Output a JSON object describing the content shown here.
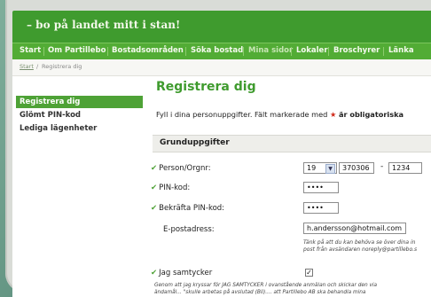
{
  "header": {
    "slogan": "– bo på landet mitt i stan!"
  },
  "nav": {
    "items": [
      {
        "label": "Start",
        "faded": false
      },
      {
        "label": "Om Partillebo",
        "faded": false
      },
      {
        "label": "Bostadsområden",
        "faded": false
      },
      {
        "label": "Söka bostad",
        "faded": false
      },
      {
        "label": "Mina sidor",
        "faded": true
      },
      {
        "label": "Lokaler",
        "faded": false
      },
      {
        "label": "Broschyrer",
        "faded": false
      },
      {
        "label": "Länka",
        "faded": false
      }
    ]
  },
  "breadcrumb": {
    "home": "Start",
    "separator": "/",
    "current": "Registrera dig"
  },
  "sidebar": {
    "items": [
      {
        "label": "Registrera dig",
        "active": true
      },
      {
        "label": "Glömt PIN-kod",
        "active": false
      },
      {
        "label": "Lediga lägenheter",
        "active": false
      }
    ]
  },
  "main": {
    "title": "Registrera dig",
    "intro_prefix": "Fyll i dina personuppgifter. Fält markerade med",
    "intro_star": "★",
    "intro_suffix": "är obligatoriska",
    "section_title": "Grunduppgifter"
  },
  "form": {
    "person_label": "Person/Orgnr:",
    "century_value": "19",
    "date_value": "370306",
    "dash": "-",
    "last4_value": "1234",
    "pin_label": "PIN-kod:",
    "pin_value": "••••",
    "pin_confirm_label": "Bekräfta PIN-kod:",
    "pin_confirm_value": "••••",
    "email_label": "E-postadress:",
    "email_value": "h.andersson@hotmail.com",
    "email_note_line1": "Tänk på att du kan behöva se över dina in",
    "email_note_line2": "post från avsändaren noreply@partillebo.s",
    "consent_label": "Jag samtycker",
    "consent_checked": "✓",
    "consent_text_line1": "Genom att jag kryssar för JAG SAMTYCKER i ovanstående anmälan och skickar den via",
    "consent_text_line2": "ändamål...  \"skulle arbetas på avslutad (Bil)....  att Partillebo AB ska behandla mina"
  },
  "colors": {
    "brand_green": "#3f9b2e",
    "nav_green": "#52ac35",
    "required_star": "#d02a1a"
  }
}
